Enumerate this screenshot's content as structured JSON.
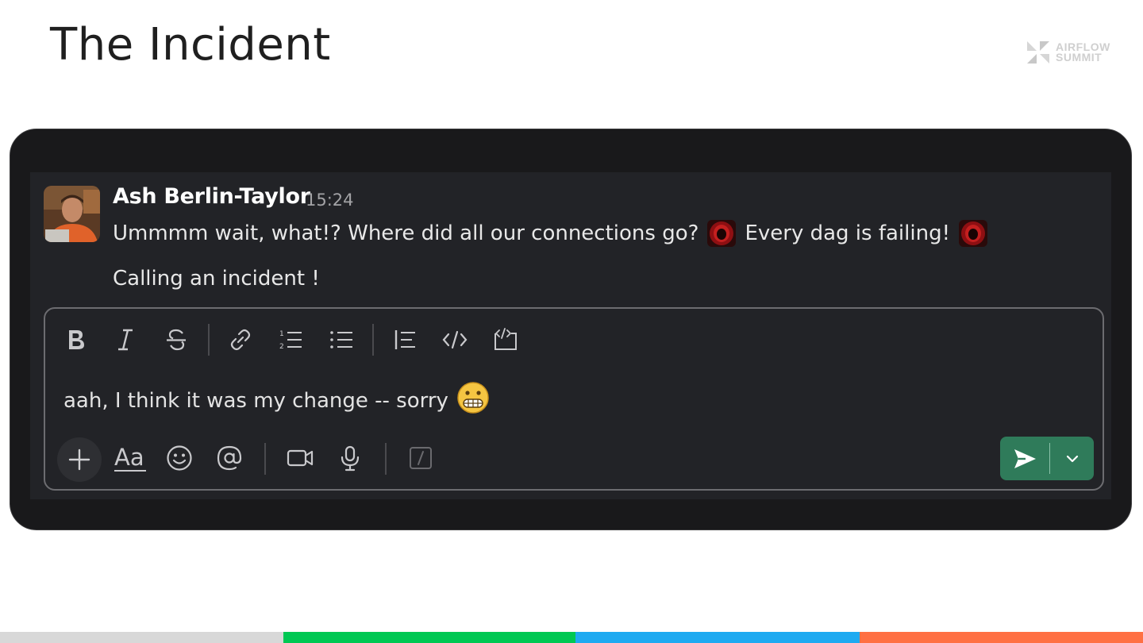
{
  "slide": {
    "title": "The Incident",
    "logo_line1": "AIRFLOW",
    "logo_line2": "SUMMIT"
  },
  "message": {
    "author": "Ash Berlin-Taylor",
    "time": "15:24",
    "line1_part1": "Ummmm wait, what!? Where did all our connections go?",
    "line1_part2": "Every dag is failing!",
    "line2": "Calling an incident !"
  },
  "composer": {
    "draft_text": "aah, I think it was my change -- sorry",
    "toolbar": [
      "bold-icon",
      "italic-icon",
      "strikethrough-icon",
      "link-icon",
      "numbered-list-icon",
      "bulleted-list-icon",
      "blockquote-icon",
      "code-icon",
      "code-block-icon"
    ],
    "actions": [
      "plus-icon",
      "formatting-icon",
      "emoji-icon",
      "mention-icon",
      "video-icon",
      "microphone-icon",
      "slash-command-icon"
    ],
    "format_label": "Aa",
    "send_color": "#2f7b5a"
  },
  "colors": {
    "panel_bg": "#19191b",
    "message_bg": "#222327",
    "footer_bar": [
      "#d8d8d8",
      "#00c853",
      "#1eaaf1",
      "#ff7043"
    ]
  }
}
